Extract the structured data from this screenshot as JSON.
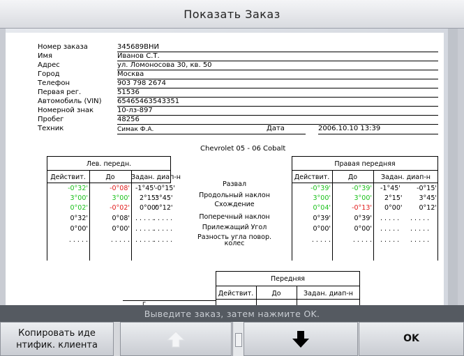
{
  "window": {
    "title": "Показать Заказ"
  },
  "order": {
    "fields": [
      {
        "label": "Номер заказа",
        "value": "345689ВНИ"
      },
      {
        "label": "Имя",
        "value": "Иванов С.Т."
      },
      {
        "label": "Адрес",
        "value": "ул. Ломоносова 30, кв. 50"
      },
      {
        "label": "Город",
        "value": "Москва"
      },
      {
        "label": "Телефон",
        "value": "903 798 2674"
      },
      {
        "label": "Первая рег.",
        "value": "51536"
      },
      {
        "label": "Автомобиль (VIN)",
        "value": "65465463543351"
      },
      {
        "label": "Номерной знак",
        "value": "10-лз-897"
      },
      {
        "label": "Пробег",
        "value": "48256"
      },
      {
        "label": "Техник",
        "value": "Симак Ф.А."
      }
    ],
    "date_label": "Дата",
    "date_value": "2006.10.10 13:39",
    "vehicle": "Chevrolet 05 - 06 Cobalt"
  },
  "alignment": {
    "left_title": "Лев. передн.",
    "right_title": "Правая передняя",
    "col_actual": "Действит.",
    "col_before": "До",
    "col_range": "Задан. диап-н",
    "params": [
      "Развал",
      "Продольный наклон",
      "Схождение",
      "Поперечный наклон",
      "Прилежащий Угол",
      "Разность угла повор. колес"
    ],
    "left_rows": [
      {
        "actual": "-0°32'",
        "before": "-0°08'",
        "min": "-1°45'",
        "max": "-0°15'"
      },
      {
        "actual": "3°00'",
        "before": "3°00'",
        "min": "2°15'",
        "max": "3°45'"
      },
      {
        "actual": "0°02'",
        "before": "-0°02'",
        "min": "0°00'",
        "max": "0°12'"
      },
      {
        "actual": "0°32'",
        "before": "0°08'",
        "min": ". . . . .",
        "max": ". . . . ."
      },
      {
        "actual": "0°00'",
        "before": "0°00'",
        "min": ". . . . .",
        "max": ". . . . ."
      },
      {
        "actual": ". . . . .",
        "before": ". . . . .",
        "min": ". . . . .",
        "max": ". . . . ."
      }
    ],
    "right_rows": [
      {
        "actual": "-0°39'",
        "before": "-0°39'",
        "min": "-1°45'",
        "max": "-0°15'"
      },
      {
        "actual": "3°00'",
        "before": "3°00'",
        "min": "2°15'",
        "max": "3°45'"
      },
      {
        "actual": "0°04'",
        "before": "-0°13'",
        "min": "0°00'",
        "max": "0°12'"
      },
      {
        "actual": "0°39'",
        "before": "0°39'",
        "min": ". . . . .",
        "max": ". . . . ."
      },
      {
        "actual": "0°00'",
        "before": "0°00'",
        "min": ". . . . .",
        "max": ". . . . ."
      },
      {
        "actual": ". . . . .",
        "before": ". . . . .",
        "min": ". . . . .",
        "max": ". . . . ."
      }
    ],
    "front_title": "Передняя",
    "partial_label": "г"
  },
  "colors": {
    "in_range": "#18c018",
    "out_of_range": "#e01818"
  },
  "status": {
    "message": "Выведите заказ, затем нажмите OK."
  },
  "buttons": {
    "copy_line1": "Копировать иде",
    "copy_line2": "нтифик. клиента",
    "up_icon": "arrow-up-icon",
    "down_icon": "arrow-down-icon",
    "ok": "OK"
  }
}
